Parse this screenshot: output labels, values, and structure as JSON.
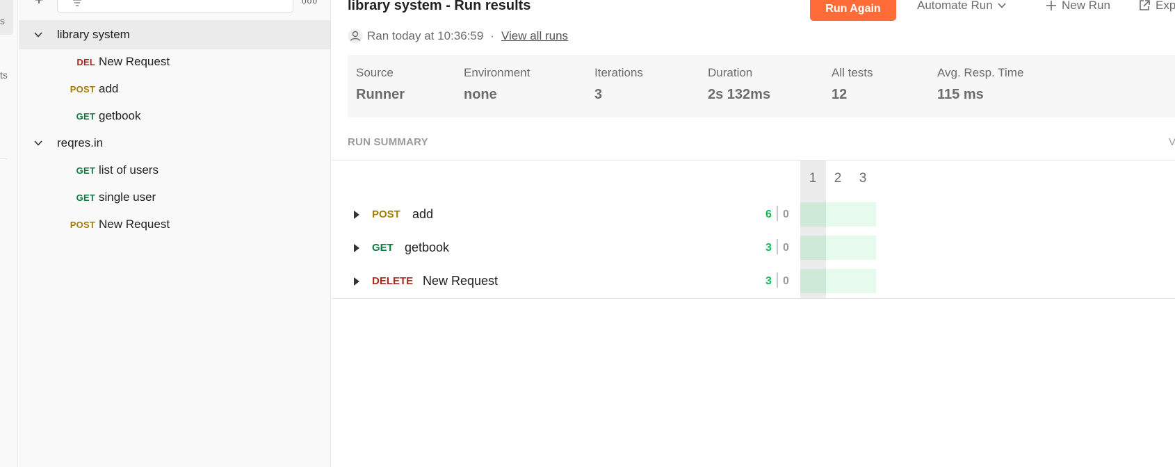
{
  "rail": {
    "items": [
      "s",
      "ts"
    ]
  },
  "sidebar": {
    "more_label": "ooo",
    "tree": [
      {
        "type": "folder",
        "label": "library system",
        "expanded": true,
        "selected": true
      },
      {
        "type": "request",
        "method": "DEL",
        "label": "New Request"
      },
      {
        "type": "request",
        "method": "POST",
        "label": "add"
      },
      {
        "type": "request",
        "method": "GET",
        "label": "getbook"
      },
      {
        "type": "folder",
        "label": "reqres.in",
        "expanded": true,
        "selected": false
      },
      {
        "type": "request",
        "method": "GET",
        "label": "list of users"
      },
      {
        "type": "request",
        "method": "GET",
        "label": "single user"
      },
      {
        "type": "request",
        "method": "POST",
        "label": "New Request"
      }
    ]
  },
  "header": {
    "title": "library system - Run results",
    "run_again": "Run Again",
    "automate_run": "Automate Run",
    "new_run": "New Run",
    "export": "Exp"
  },
  "run_info": {
    "ran_text": "Ran today at 10:36:59",
    "separator": "·",
    "view_all_runs": "View all runs"
  },
  "stats": [
    {
      "label": "Source",
      "value": "Runner"
    },
    {
      "label": "Environment",
      "value": "none"
    },
    {
      "label": "Iterations",
      "value": "3"
    },
    {
      "label": "Duration",
      "value": "2s 132ms"
    },
    {
      "label": "All tests",
      "value": "12"
    },
    {
      "label": "Avg. Resp. Time",
      "value": "115 ms"
    }
  ],
  "summary": {
    "heading": "RUN SUMMARY",
    "right_link": "V",
    "iterations": [
      "1",
      "2",
      "3"
    ],
    "selected_iteration": "1",
    "rows": [
      {
        "method": "POST",
        "name": "add",
        "passed": "6",
        "failed": "0"
      },
      {
        "method": "GET",
        "name": "getbook",
        "passed": "3",
        "failed": "0"
      },
      {
        "method": "DELETE",
        "name": "New Request",
        "passed": "3",
        "failed": "0"
      }
    ]
  },
  "colors": {
    "accent": "#ff6c37",
    "post": "#a47e00",
    "get": "#107c41",
    "delete": "#b3261e",
    "pass": "#0cbb52"
  }
}
